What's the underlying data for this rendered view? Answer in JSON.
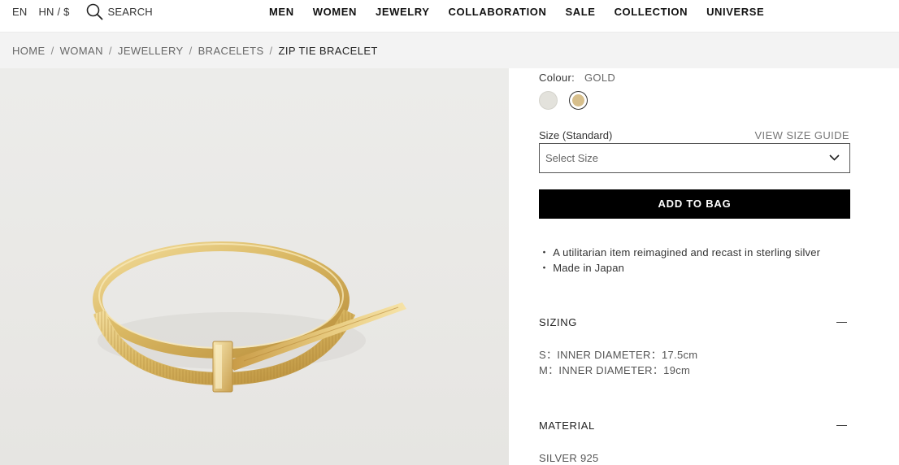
{
  "header": {
    "language": "EN",
    "currency": "HN / $",
    "search_label": "SEARCH",
    "nav": [
      "MEN",
      "WOMEN",
      "JEWELRY",
      "COLLABORATION",
      "SALE",
      "COLLECTION",
      "UNIVERSE"
    ]
  },
  "breadcrumb": {
    "items": [
      "HOME",
      "WOMAN",
      "JEWELLERY",
      "BRACELETS"
    ],
    "separator": "/",
    "current": "ZIP TIE BRACELET"
  },
  "product": {
    "colour_label": "Colour:",
    "colour_value": "GOLD",
    "swatches": [
      {
        "name": "silver",
        "color": "#e3e2dc",
        "selected": false
      },
      {
        "name": "gold",
        "color": "#d7bf8c",
        "selected": true
      }
    ],
    "size_label": "Size (Standard)",
    "size_guide_label": "VIEW SIZE GUIDE",
    "size_placeholder": "Select Size",
    "add_to_bag_label": "ADD TO BAG",
    "features": [
      "A utilitarian item reimagined and recast in sterling silver",
      "Made in Japan"
    ],
    "bullet_char": "・"
  },
  "sections": {
    "sizing": {
      "title": "SIZING",
      "lines": [
        "S：INNER DIAMETER：17.5cm",
        "M：INNER DIAMETER：19cm"
      ]
    },
    "material": {
      "title": "MATERIAL",
      "lines": [
        "SILVER 925"
      ]
    }
  },
  "icons": {
    "search": "search-icon",
    "chevron": "chevron-down-icon",
    "collapse": "minus-icon"
  },
  "colors": {
    "accent": "#000000",
    "background_panel": "#f3f3f3",
    "gold": "#d7bf8c"
  }
}
